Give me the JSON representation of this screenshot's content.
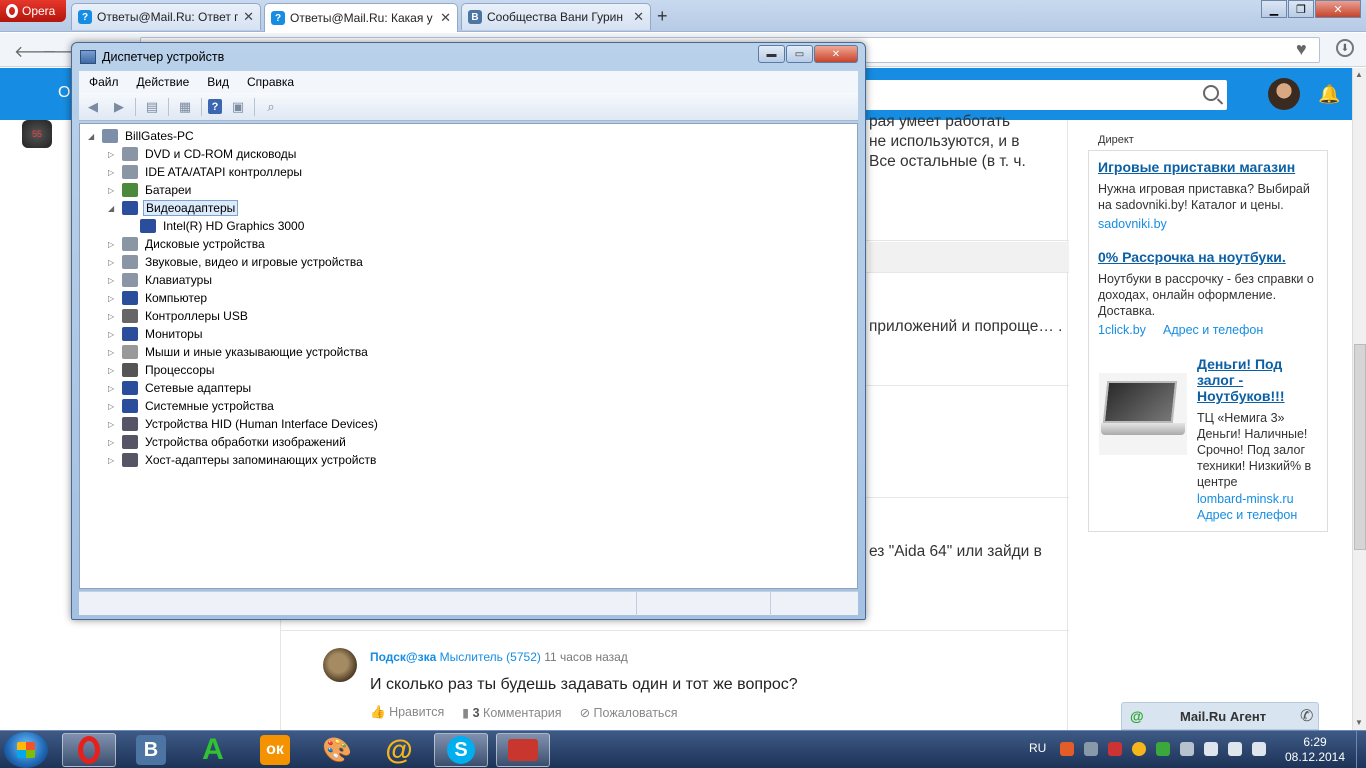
{
  "browser": {
    "menu_label": "Opera",
    "tabs": [
      {
        "title": "Ответы@Mail.Ru: Ответ п",
        "close": "✕",
        "fav": "?"
      },
      {
        "title": "Ответы@Mail.Ru: Какая у",
        "close": "✕",
        "fav": "?"
      },
      {
        "title": "Сообщества Вани Гурин",
        "close": "✕",
        "fav": "B"
      }
    ],
    "newtab": "+",
    "address_value": ""
  },
  "page": {
    "header_letter": "О",
    "search_placeholder": "",
    "left_badge": "55",
    "snippets": [
      "рая умеет работать",
      "не используются, и в",
      "Все остальные (в т. ч.",
      "приложений и попроще…  .",
      "ез \"Aida 64\" или зайди в"
    ],
    "answer": {
      "nick": "Подск@зка",
      "rank": "Мыслитель (5752)",
      "time": "11 часов назад",
      "text": "И сколько раз ты будешь задавать один и тот же вопрос?",
      "like": "Нравится",
      "comments_count": "3",
      "comments": "Комментария",
      "report": "Пожаловаться"
    },
    "ads": {
      "label": "Директ",
      "items": [
        {
          "title": "Игровые приставки магазин",
          "text": "Нужна игровая приставка? Выбирай на sadovniki.by! Каталог и цены.",
          "link": "sadovniki.by"
        },
        {
          "title": "0% Рассрочка на ноутбуки.",
          "text": "Ноутбуки в рассрочку - без справки о доходах, онлайн оформление. Доставка.",
          "link": "1click.by",
          "link2": "Адрес и телефон"
        },
        {
          "title": "Деньги! Под залог - Ноутбуков!!!",
          "text": "ТЦ «Немига 3» Деньги! Наличные! Срочно! Под залог техники! Низкий% в центре",
          "link": "lombard-minsk.ru",
          "link2": "Адрес и телефон"
        }
      ]
    },
    "agent": {
      "label": "Mail.Ru Агент"
    }
  },
  "device_manager": {
    "title": "Диспетчер устройств",
    "menu": [
      "Файл",
      "Действие",
      "Вид",
      "Справка"
    ],
    "root": "BillGates-PC",
    "nodes": [
      {
        "label": "DVD и CD-ROM дисководы"
      },
      {
        "label": "IDE ATA/ATAPI контроллеры"
      },
      {
        "label": "Батареи"
      },
      {
        "label": "Видеоадаптеры",
        "expanded": true,
        "selected": true
      },
      {
        "label": "Intel(R) HD Graphics 3000",
        "child": true
      },
      {
        "label": "Дисковые устройства"
      },
      {
        "label": "Звуковые, видео и игровые устройства"
      },
      {
        "label": "Клавиатуры"
      },
      {
        "label": "Компьютер"
      },
      {
        "label": "Контроллеры USB"
      },
      {
        "label": "Мониторы"
      },
      {
        "label": "Мыши и иные указывающие устройства"
      },
      {
        "label": "Процессоры"
      },
      {
        "label": "Сетевые адаптеры"
      },
      {
        "label": "Системные устройства"
      },
      {
        "label": "Устройства HID (Human Interface Devices)"
      },
      {
        "label": "Устройства обработки изображений"
      },
      {
        "label": "Хост-адаптеры запоминающих устройств"
      }
    ]
  },
  "taskbar": {
    "lang": "RU",
    "time": "6:29",
    "date": "08.12.2014",
    "apps": [
      "opera",
      "vk",
      "a",
      "odnoklassniki",
      "paint",
      "mail-agent",
      "skype",
      "toolbox"
    ]
  }
}
